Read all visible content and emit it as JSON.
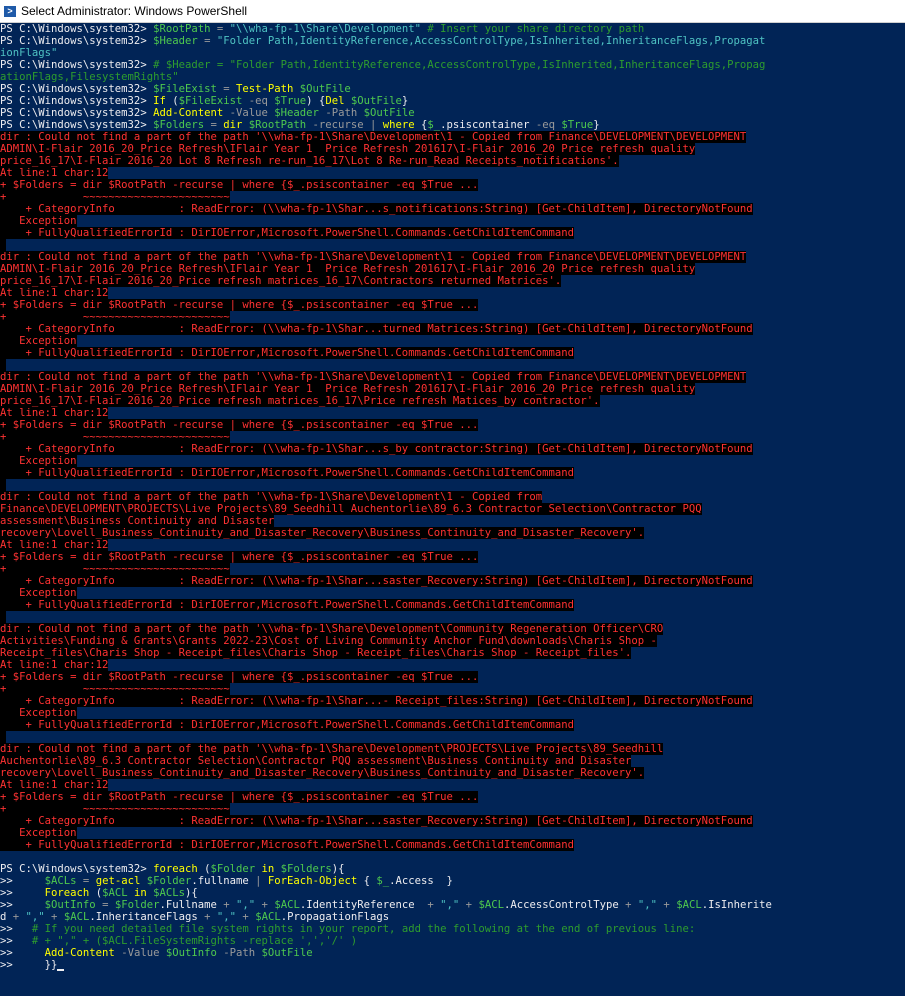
{
  "window": {
    "title": "Select Administrator: Windows PowerShell"
  },
  "colors": {
    "background": "#012456",
    "error_fg": "#ff3232",
    "error_bg": "#000000",
    "command": "#ffff00",
    "variable": "#4ec94e",
    "string": "#4fc3c3",
    "comment": "#2e9d2e"
  },
  "lines": [
    {
      "k": "code",
      "s": [
        [
          "ps",
          "PS C:\\Windows\\system32> "
        ],
        [
          "var",
          "$RootPath"
        ],
        [
          "op",
          " = "
        ],
        [
          "str",
          "\"\\\\wha-fp-1\\Share\\Development\""
        ],
        [
          "cmt",
          " # Insert your share directory path"
        ]
      ]
    },
    {
      "k": "code",
      "s": [
        [
          "ps",
          "PS C:\\Windows\\system32> "
        ],
        [
          "var",
          "$Header"
        ],
        [
          "op",
          " = "
        ],
        [
          "str",
          "\"Folder Path,IdentityReference,AccessControlType,IsInherited,InheritanceFlags,Propagat"
        ]
      ]
    },
    {
      "k": "code",
      "s": [
        [
          "str",
          "ionFlags\""
        ]
      ]
    },
    {
      "k": "code",
      "s": [
        [
          "ps",
          "PS C:\\Windows\\system32> "
        ],
        [
          "cmt",
          "# $Header = \"Folder Path,IdentityReference,AccessControlType,IsInherited,InheritanceFlags,Propag"
        ]
      ]
    },
    {
      "k": "code",
      "s": [
        [
          "cmt",
          "ationFlags,FilesystemRights\""
        ]
      ]
    },
    {
      "k": "code",
      "s": [
        [
          "ps",
          "PS C:\\Windows\\system32> "
        ],
        [
          "var",
          "$FileExist"
        ],
        [
          "op",
          " = "
        ],
        [
          "cmd",
          "Test-Path "
        ],
        [
          "var",
          "$OutFile"
        ]
      ]
    },
    {
      "k": "code",
      "s": [
        [
          "ps",
          "PS C:\\Windows\\system32> "
        ],
        [
          "cmd",
          "If "
        ],
        [
          "plain",
          "("
        ],
        [
          "var",
          "$FileExist"
        ],
        [
          "param",
          " -eq "
        ],
        [
          "var",
          "$True"
        ],
        [
          "plain",
          ") {"
        ],
        [
          "cmd",
          "Del "
        ],
        [
          "var",
          "$OutFile"
        ],
        [
          "plain",
          "}"
        ]
      ]
    },
    {
      "k": "code",
      "s": [
        [
          "ps",
          "PS C:\\Windows\\system32> "
        ],
        [
          "cmd",
          "Add-Content "
        ],
        [
          "param",
          "-Value "
        ],
        [
          "var",
          "$Header"
        ],
        [
          "param",
          " -Path "
        ],
        [
          "var",
          "$OutFile"
        ]
      ]
    },
    {
      "k": "code",
      "s": [
        [
          "ps",
          "PS C:\\Windows\\system32> "
        ],
        [
          "var",
          "$Folders"
        ],
        [
          "op",
          " = "
        ],
        [
          "cmd",
          "dir "
        ],
        [
          "var",
          "$RootPath"
        ],
        [
          "param",
          " -recurse "
        ],
        [
          "op",
          "| "
        ],
        [
          "cmd",
          "where "
        ],
        [
          "plain",
          "{"
        ],
        [
          "var",
          "$_"
        ],
        [
          "plain",
          ".psiscontainer "
        ],
        [
          "param",
          "-eq "
        ],
        [
          "var",
          "$True"
        ],
        [
          "plain",
          "}"
        ]
      ]
    },
    {
      "k": "err",
      "t": "dir : Could not find a part of the path '\\\\wha-fp-1\\Share\\Development\\1 - Copied from Finance\\DEVELOPMENT\\DEVELOPMENT"
    },
    {
      "k": "err",
      "t": "ADMIN\\I-Flair 2016_20_Price Refresh\\IFlair Year 1  Price Refresh 201617\\I-Flair 2016_20 Price refresh quality"
    },
    {
      "k": "err",
      "t": "price_16_17\\I-Flair 2016_20 Lot 8 Refresh re-run_16_17\\Lot 8 Re-run_Read Receipts_notifications'."
    },
    {
      "k": "err",
      "t": "At line:1 char:12"
    },
    {
      "k": "err",
      "t": "+ $Folders = dir $RootPath -recurse | where {$_.psiscontainer -eq $True ..."
    },
    {
      "k": "err",
      "t": "+            ~~~~~~~~~~~~~~~~~~~~~~~"
    },
    {
      "k": "err",
      "t": "    + CategoryInfo          : ReadError: (\\\\wha-fp-1\\Shar...s_notifications:String) [Get-ChildItem], DirectoryNotFound"
    },
    {
      "k": "err",
      "t": "   Exception"
    },
    {
      "k": "err",
      "t": "    + FullyQualifiedErrorId : DirIOError,Microsoft.PowerShell.Commands.GetChildItemCommand"
    },
    {
      "k": "err",
      "t": " "
    },
    {
      "k": "err",
      "t": "dir : Could not find a part of the path '\\\\wha-fp-1\\Share\\Development\\1 - Copied from Finance\\DEVELOPMENT\\DEVELOPMENT"
    },
    {
      "k": "err",
      "t": "ADMIN\\I-Flair 2016_20_Price Refresh\\IFlair Year 1  Price Refresh 201617\\I-Flair 2016_20 Price refresh quality"
    },
    {
      "k": "err",
      "t": "price_16_17\\I-Flair 2016_20_Price refresh matrices_16_17\\Contractors returned Matrices'."
    },
    {
      "k": "err",
      "t": "At line:1 char:12"
    },
    {
      "k": "err",
      "t": "+ $Folders = dir $RootPath -recurse | where {$_.psiscontainer -eq $True ..."
    },
    {
      "k": "err",
      "t": "+            ~~~~~~~~~~~~~~~~~~~~~~~"
    },
    {
      "k": "err",
      "t": "    + CategoryInfo          : ReadError: (\\\\wha-fp-1\\Shar...turned Matrices:String) [Get-ChildItem], DirectoryNotFound"
    },
    {
      "k": "err",
      "t": "   Exception"
    },
    {
      "k": "err",
      "t": "    + FullyQualifiedErrorId : DirIOError,Microsoft.PowerShell.Commands.GetChildItemCommand"
    },
    {
      "k": "err",
      "t": " "
    },
    {
      "k": "err",
      "t": "dir : Could not find a part of the path '\\\\wha-fp-1\\Share\\Development\\1 - Copied from Finance\\DEVELOPMENT\\DEVELOPMENT"
    },
    {
      "k": "err",
      "t": "ADMIN\\I-Flair 2016_20_Price Refresh\\IFlair Year 1  Price Refresh 201617\\I-Flair 2016_20 Price refresh quality"
    },
    {
      "k": "err",
      "t": "price_16_17\\I-Flair 2016_20_Price refresh matrices_16_17\\Price refresh Matices_by contractor'."
    },
    {
      "k": "err",
      "t": "At line:1 char:12"
    },
    {
      "k": "err",
      "t": "+ $Folders = dir $RootPath -recurse | where {$_.psiscontainer -eq $True ..."
    },
    {
      "k": "err",
      "t": "+            ~~~~~~~~~~~~~~~~~~~~~~~"
    },
    {
      "k": "err",
      "t": "    + CategoryInfo          : ReadError: (\\\\wha-fp-1\\Shar...s_by contractor:String) [Get-ChildItem], DirectoryNotFound"
    },
    {
      "k": "err",
      "t": "   Exception"
    },
    {
      "k": "err",
      "t": "    + FullyQualifiedErrorId : DirIOError,Microsoft.PowerShell.Commands.GetChildItemCommand"
    },
    {
      "k": "err",
      "t": " "
    },
    {
      "k": "err",
      "t": "dir : Could not find a part of the path '\\\\wha-fp-1\\Share\\Development\\1 - Copied from"
    },
    {
      "k": "err",
      "t": "Finance\\DEVELOPMENT\\PROJECTS\\Live Projects\\89_Seedhill Auchentorlie\\89_6.3 Contractor Selection\\Contractor PQQ"
    },
    {
      "k": "err",
      "t": "assessment\\Business Continuity and Disaster"
    },
    {
      "k": "err",
      "t": "recovery\\Lovell_Business_Continuity_and_Disaster_Recovery\\Business_Continuity_and_Disaster_Recovery'."
    },
    {
      "k": "err",
      "t": "At line:1 char:12"
    },
    {
      "k": "err",
      "t": "+ $Folders = dir $RootPath -recurse | where {$_.psiscontainer -eq $True ..."
    },
    {
      "k": "err",
      "t": "+            ~~~~~~~~~~~~~~~~~~~~~~~"
    },
    {
      "k": "err",
      "t": "    + CategoryInfo          : ReadError: (\\\\wha-fp-1\\Shar...saster_Recovery:String) [Get-ChildItem], DirectoryNotFound"
    },
    {
      "k": "err",
      "t": "   Exception"
    },
    {
      "k": "err",
      "t": "    + FullyQualifiedErrorId : DirIOError,Microsoft.PowerShell.Commands.GetChildItemCommand"
    },
    {
      "k": "err",
      "t": " "
    },
    {
      "k": "err",
      "t": "dir : Could not find a part of the path '\\\\wha-fp-1\\Share\\Development\\Community Regeneration Officer\\CRO"
    },
    {
      "k": "err",
      "t": "Activities\\Funding & Grants\\Grants 2022-23\\Cost of Living Community Anchor Fund\\downloads\\Charis Shop -"
    },
    {
      "k": "err",
      "t": "Receipt_files\\Charis Shop - Receipt_files\\Charis Shop - Receipt_files\\Charis Shop - Receipt_files'."
    },
    {
      "k": "err",
      "t": "At line:1 char:12"
    },
    {
      "k": "err",
      "t": "+ $Folders = dir $RootPath -recurse | where {$_.psiscontainer -eq $True ..."
    },
    {
      "k": "err",
      "t": "+            ~~~~~~~~~~~~~~~~~~~~~~~"
    },
    {
      "k": "err",
      "t": "    + CategoryInfo          : ReadError: (\\\\wha-fp-1\\Shar...- Receipt_files:String) [Get-ChildItem], DirectoryNotFound"
    },
    {
      "k": "err",
      "t": "   Exception"
    },
    {
      "k": "err",
      "t": "    + FullyQualifiedErrorId : DirIOError,Microsoft.PowerShell.Commands.GetChildItemCommand"
    },
    {
      "k": "err",
      "t": " "
    },
    {
      "k": "err",
      "t": "dir : Could not find a part of the path '\\\\wha-fp-1\\Share\\Development\\PROJECTS\\Live Projects\\89_Seedhill"
    },
    {
      "k": "err",
      "t": "Auchentorlie\\89_6.3 Contractor Selection\\Contractor PQQ assessment\\Business Continuity and Disaster"
    },
    {
      "k": "err",
      "t": "recovery\\Lovell_Business_Continuity_and_Disaster_Recovery\\Business_Continuity_and_Disaster_Recovery'."
    },
    {
      "k": "err",
      "t": "At line:1 char:12"
    },
    {
      "k": "err",
      "t": "+ $Folders = dir $RootPath -recurse | where {$_.psiscontainer -eq $True ..."
    },
    {
      "k": "err",
      "t": "+            ~~~~~~~~~~~~~~~~~~~~~~~"
    },
    {
      "k": "err",
      "t": "    + CategoryInfo          : ReadError: (\\\\wha-fp-1\\Shar...saster_Recovery:String) [Get-ChildItem], DirectoryNotFound"
    },
    {
      "k": "err",
      "t": "   Exception"
    },
    {
      "k": "err",
      "t": "    + FullyQualifiedErrorId : DirIOError,Microsoft.PowerShell.Commands.GetChildItemCommand"
    },
    {
      "k": "blank",
      "t": ""
    },
    {
      "k": "code",
      "s": [
        [
          "ps",
          "PS C:\\Windows\\system32> "
        ],
        [
          "cmd",
          "foreach "
        ],
        [
          "plain",
          "("
        ],
        [
          "var",
          "$Folder"
        ],
        [
          "cmd",
          " in "
        ],
        [
          "var",
          "$Folders"
        ],
        [
          "plain",
          "){"
        ]
      ]
    },
    {
      "k": "code",
      "s": [
        [
          "ps",
          ">>     "
        ],
        [
          "var",
          "$ACLs"
        ],
        [
          "op",
          " = "
        ],
        [
          "cmd",
          "get-acl "
        ],
        [
          "var",
          "$Folder"
        ],
        [
          "plain",
          ".fullname "
        ],
        [
          "op",
          "| "
        ],
        [
          "cmd",
          "ForEach-Object "
        ],
        [
          "plain",
          "{ "
        ],
        [
          "var",
          "$_"
        ],
        [
          "plain",
          ".Access  }"
        ]
      ]
    },
    {
      "k": "code",
      "s": [
        [
          "ps",
          ">>     "
        ],
        [
          "cmd",
          "Foreach "
        ],
        [
          "plain",
          "("
        ],
        [
          "var",
          "$ACL"
        ],
        [
          "cmd",
          " in "
        ],
        [
          "var",
          "$ACLs"
        ],
        [
          "plain",
          "){"
        ]
      ]
    },
    {
      "k": "code",
      "s": [
        [
          "ps",
          ">>     "
        ],
        [
          "var",
          "$OutInfo"
        ],
        [
          "op",
          " = "
        ],
        [
          "var",
          "$Folder"
        ],
        [
          "plain",
          ".Fullname "
        ],
        [
          "op",
          "+ "
        ],
        [
          "str",
          "\",\""
        ],
        [
          "op",
          " + "
        ],
        [
          "var",
          "$ACL"
        ],
        [
          "plain",
          ".IdentityReference  "
        ],
        [
          "op",
          "+ "
        ],
        [
          "str",
          "\",\""
        ],
        [
          "op",
          " + "
        ],
        [
          "var",
          "$ACL"
        ],
        [
          "plain",
          ".AccessControlType "
        ],
        [
          "op",
          "+ "
        ],
        [
          "str",
          "\",\""
        ],
        [
          "op",
          " + "
        ],
        [
          "var",
          "$ACL"
        ],
        [
          "plain",
          ".IsInherite"
        ]
      ]
    },
    {
      "k": "code",
      "s": [
        [
          "plain",
          "d "
        ],
        [
          "op",
          "+ "
        ],
        [
          "str",
          "\",\""
        ],
        [
          "op",
          " + "
        ],
        [
          "var",
          "$ACL"
        ],
        [
          "plain",
          ".InheritanceFlags "
        ],
        [
          "op",
          "+ "
        ],
        [
          "str",
          "\",\""
        ],
        [
          "op",
          " + "
        ],
        [
          "var",
          "$ACL"
        ],
        [
          "plain",
          ".PropagationFlags"
        ]
      ]
    },
    {
      "k": "code",
      "s": [
        [
          "ps",
          ">>   "
        ],
        [
          "cmt",
          "# If you need detailed file system rights in your report, add the following at the end of previous line:"
        ]
      ]
    },
    {
      "k": "code",
      "s": [
        [
          "ps",
          ">>   "
        ],
        [
          "cmt",
          "# + \",\" + ($ACL.FileSystemRights -replace ',','/' )"
        ]
      ]
    },
    {
      "k": "code",
      "s": [
        [
          "ps",
          ">>     "
        ],
        [
          "cmd",
          "Add-Content "
        ],
        [
          "param",
          "-Value "
        ],
        [
          "var",
          "$OutInfo"
        ],
        [
          "param",
          " -Path "
        ],
        [
          "var",
          "$OutFile"
        ]
      ]
    },
    {
      "k": "code",
      "s": [
        [
          "ps",
          ">>     "
        ],
        [
          "plain",
          "}}"
        ]
      ],
      "cursor": true
    }
  ]
}
